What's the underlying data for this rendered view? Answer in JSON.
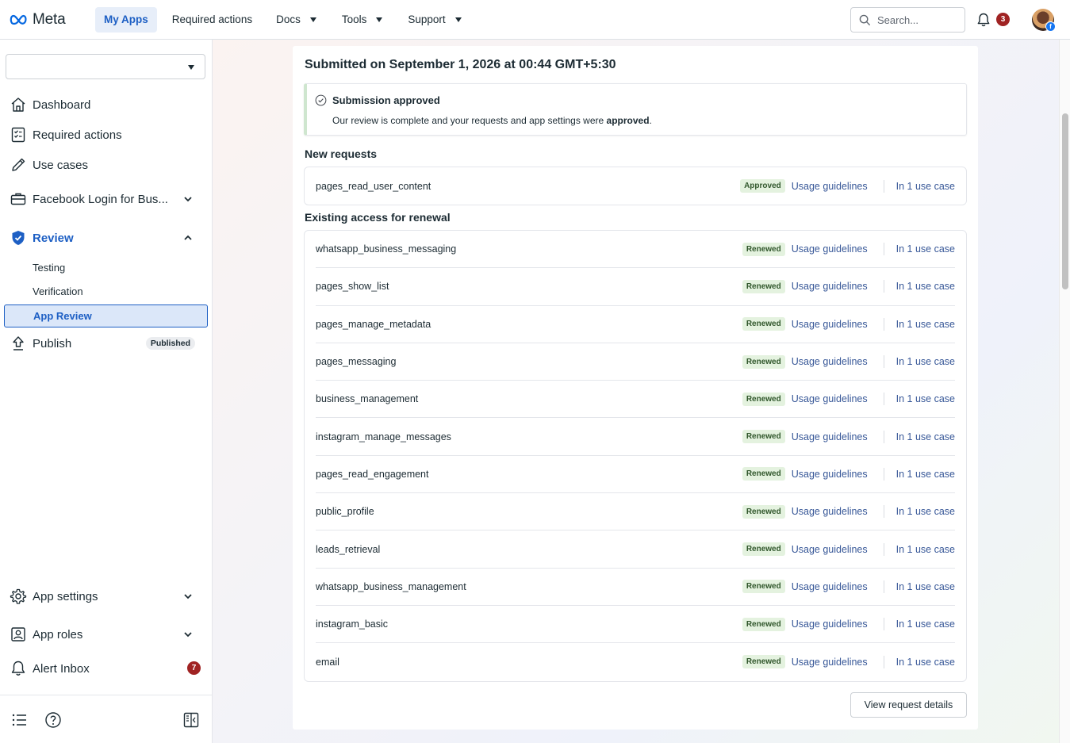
{
  "topnav": {
    "logo_text": "Meta",
    "items": [
      {
        "label": "My Apps",
        "active": true,
        "dropdown": false
      },
      {
        "label": "Required actions",
        "active": false,
        "dropdown": false
      },
      {
        "label": "Docs",
        "active": false,
        "dropdown": true
      },
      {
        "label": "Tools",
        "active": false,
        "dropdown": true
      },
      {
        "label": "Support",
        "active": false,
        "dropdown": true
      }
    ],
    "search_placeholder": "Search...",
    "notification_count": "3",
    "avatar_icon": "user-avatar",
    "accent_color": "#1d5fc4"
  },
  "sidebar": {
    "app_selector_value": "",
    "items": [
      {
        "label": "Dashboard",
        "icon": "home-icon"
      },
      {
        "label": "Required actions",
        "icon": "checklist-icon"
      },
      {
        "label": "Use cases",
        "icon": "pencil-icon"
      },
      {
        "label": "Facebook Login for Bus...",
        "icon": "briefcase-icon"
      },
      {
        "label": "Review",
        "icon": "shield-check-icon"
      },
      {
        "label": "Publish",
        "icon": "upload-icon"
      }
    ],
    "review_sub": [
      "Testing",
      "Verification",
      "App Review"
    ],
    "publish_badge": "Published",
    "bottom_items": [
      {
        "label": "App settings",
        "icon": "gear-icon"
      },
      {
        "label": "App roles",
        "icon": "person-badge-icon"
      },
      {
        "label": "Alert Inbox",
        "icon": "bell-icon"
      }
    ],
    "alert_count": "7"
  },
  "main": {
    "submitted_title": "Submitted on September 1, 2026 at 00:44 GMT+5:30",
    "approval": {
      "title": "Submission approved",
      "text_before": "Our review is complete and your requests and app settings were ",
      "text_bold": "approved",
      "text_after": ".",
      "color": "#cfe6cf"
    },
    "new_requests_title": "New requests",
    "new_requests": [
      {
        "permission": "pages_read_user_content",
        "status": "Approved",
        "guidelines": "Usage guidelines",
        "use_case": "In 1 use case"
      }
    ],
    "renewal_title": "Existing access for renewal",
    "renewals": [
      {
        "permission": "whatsapp_business_messaging",
        "status": "Renewed",
        "guidelines": "Usage guidelines",
        "use_case": "In 1 use case"
      },
      {
        "permission": "pages_show_list",
        "status": "Renewed",
        "guidelines": "Usage guidelines",
        "use_case": "In 1 use case"
      },
      {
        "permission": "pages_manage_metadata",
        "status": "Renewed",
        "guidelines": "Usage guidelines",
        "use_case": "In 1 use case"
      },
      {
        "permission": "pages_messaging",
        "status": "Renewed",
        "guidelines": "Usage guidelines",
        "use_case": "In 1 use case"
      },
      {
        "permission": "business_management",
        "status": "Renewed",
        "guidelines": "Usage guidelines",
        "use_case": "In 1 use case"
      },
      {
        "permission": "instagram_manage_messages",
        "status": "Renewed",
        "guidelines": "Usage guidelines",
        "use_case": "In 1 use case"
      },
      {
        "permission": "pages_read_engagement",
        "status": "Renewed",
        "guidelines": "Usage guidelines",
        "use_case": "In 1 use case"
      },
      {
        "permission": "public_profile",
        "status": "Renewed",
        "guidelines": "Usage guidelines",
        "use_case": "In 1 use case"
      },
      {
        "permission": "leads_retrieval",
        "status": "Renewed",
        "guidelines": "Usage guidelines",
        "use_case": "In 1 use case"
      },
      {
        "permission": "whatsapp_business_management",
        "status": "Renewed",
        "guidelines": "Usage guidelines",
        "use_case": "In 1 use case"
      },
      {
        "permission": "instagram_basic",
        "status": "Renewed",
        "guidelines": "Usage guidelines",
        "use_case": "In 1 use case"
      },
      {
        "permission": "email",
        "status": "Renewed",
        "guidelines": "Usage guidelines",
        "use_case": "In 1 use case"
      }
    ],
    "view_details_label": "View request details"
  }
}
